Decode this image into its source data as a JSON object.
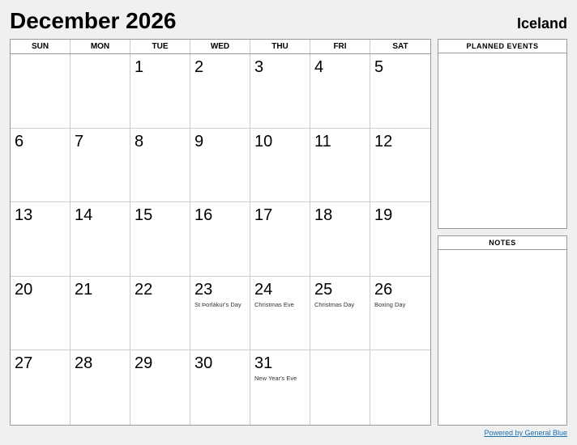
{
  "header": {
    "title": "December 2026",
    "country": "Iceland"
  },
  "day_headers": [
    "SUN",
    "MON",
    "TUE",
    "WED",
    "THU",
    "FRI",
    "SAT"
  ],
  "weeks": [
    [
      {
        "day": "",
        "holiday": ""
      },
      {
        "day": "",
        "holiday": ""
      },
      {
        "day": "1",
        "holiday": ""
      },
      {
        "day": "2",
        "holiday": ""
      },
      {
        "day": "3",
        "holiday": ""
      },
      {
        "day": "4",
        "holiday": ""
      },
      {
        "day": "5",
        "holiday": ""
      }
    ],
    [
      {
        "day": "6",
        "holiday": ""
      },
      {
        "day": "7",
        "holiday": ""
      },
      {
        "day": "8",
        "holiday": ""
      },
      {
        "day": "9",
        "holiday": ""
      },
      {
        "day": "10",
        "holiday": ""
      },
      {
        "day": "11",
        "holiday": ""
      },
      {
        "day": "12",
        "holiday": ""
      }
    ],
    [
      {
        "day": "13",
        "holiday": ""
      },
      {
        "day": "14",
        "holiday": ""
      },
      {
        "day": "15",
        "holiday": ""
      },
      {
        "day": "16",
        "holiday": ""
      },
      {
        "day": "17",
        "holiday": ""
      },
      {
        "day": "18",
        "holiday": ""
      },
      {
        "day": "19",
        "holiday": ""
      }
    ],
    [
      {
        "day": "20",
        "holiday": ""
      },
      {
        "day": "21",
        "holiday": ""
      },
      {
        "day": "22",
        "holiday": ""
      },
      {
        "day": "23",
        "holiday": "St Þorlákur's Day"
      },
      {
        "day": "24",
        "holiday": "Christmas Eve"
      },
      {
        "day": "25",
        "holiday": "Christmas Day"
      },
      {
        "day": "26",
        "holiday": "Boxing Day"
      }
    ],
    [
      {
        "day": "27",
        "holiday": ""
      },
      {
        "day": "28",
        "holiday": ""
      },
      {
        "day": "29",
        "holiday": ""
      },
      {
        "day": "30",
        "holiday": ""
      },
      {
        "day": "31",
        "holiday": "New Year's Eve"
      },
      {
        "day": "",
        "holiday": ""
      },
      {
        "day": "",
        "holiday": ""
      }
    ]
  ],
  "sidebar": {
    "planned_events_label": "PLANNED EVENTS",
    "notes_label": "NOTES"
  },
  "footer": {
    "text": "Powered by General Blue"
  }
}
